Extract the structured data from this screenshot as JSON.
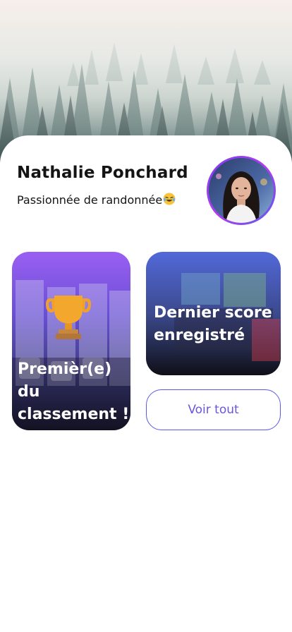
{
  "profile": {
    "name": "Nathalie Ponchard",
    "bio": "Passionnée de randonnée",
    "bio_emoji": "laughing-tears-emoji",
    "avatar_ring_color": "#7a3df0"
  },
  "cards": {
    "ranking": {
      "title": "Premièr(e) du classement !",
      "icon": "trophy-icon",
      "accent": "#8a4df5"
    },
    "last_score": {
      "title": "Dernier score enregistré",
      "accent": "#4a63d8"
    }
  },
  "actions": {
    "view_all_label": "Voir tout",
    "accent": "#5a5ae6"
  }
}
